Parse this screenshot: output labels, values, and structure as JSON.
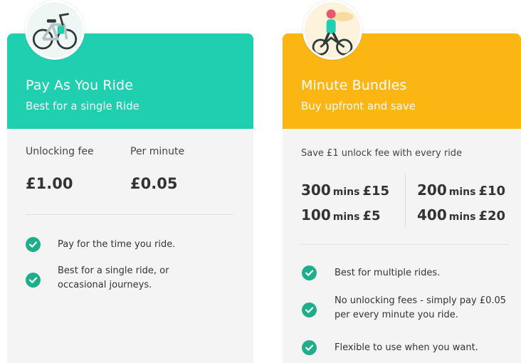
{
  "pay_as_you_ride": {
    "title": "Pay As You Ride",
    "subtitle": "Best for a single Ride",
    "unlock_label": "Unlocking fee",
    "unlock_price": "£1.00",
    "minute_label": "Per minute",
    "minute_price": "£0.05",
    "features": [
      "Pay for the time you ride.",
      "Best for a single ride, or occasional journeys."
    ],
    "header_color": "#1fcfb0",
    "icon": "bike-illustration"
  },
  "minute_bundles": {
    "title": "Minute Bundles",
    "subtitle": "Buy upfront and save",
    "saving_note": "Save £1 unlock fee with every ride",
    "bundles": [
      {
        "minutes": "300",
        "unit": "mins",
        "price": "£15"
      },
      {
        "minutes": "100",
        "unit": "mins",
        "price": "£5"
      },
      {
        "minutes": "200",
        "unit": "mins",
        "price": "£10"
      },
      {
        "minutes": "400",
        "unit": "mins",
        "price": "£20"
      }
    ],
    "features": [
      "Best for multiple rides.",
      "No unlocking fees - simply pay £0.05 per every minute you ride.",
      "Flexible to use when you want."
    ],
    "header_color": "#fcb614",
    "icon": "rider-illustration"
  },
  "check_color": "#1fae8c"
}
